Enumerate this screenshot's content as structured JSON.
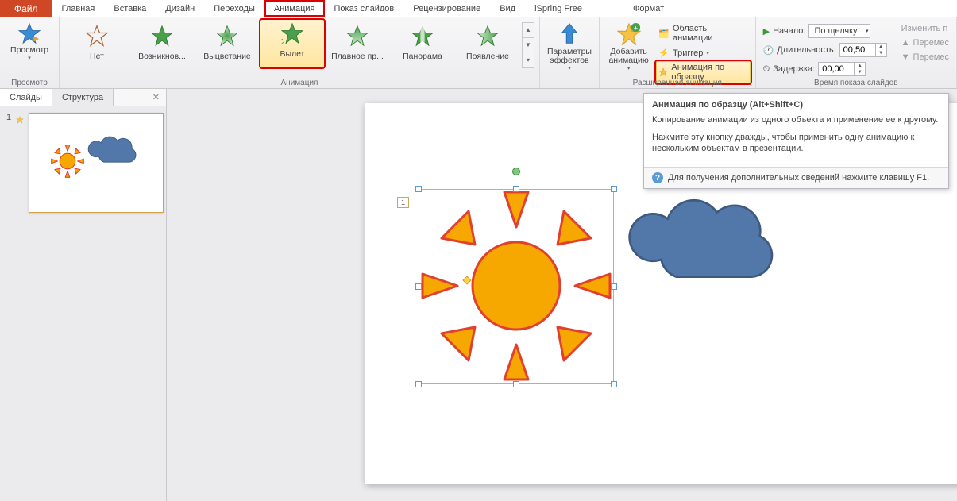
{
  "tabs": {
    "file": "Файл",
    "home": "Главная",
    "insert": "Вставка",
    "design": "Дизайн",
    "transitions": "Переходы",
    "animation": "Анимация",
    "slideshow": "Показ слайдов",
    "review": "Рецензирование",
    "view": "Вид",
    "ispring": "iSpring Free",
    "format": "Формат"
  },
  "ribbon": {
    "preview": {
      "label": "Просмотр",
      "group": "Просмотр"
    },
    "gallery": {
      "group": "Анимация",
      "items": {
        "none": "Нет",
        "appear": "Возникнов...",
        "fade": "Выцветание",
        "flyin": "Вылет",
        "floatin": "Плавное пр...",
        "panorama": "Панорама",
        "appear2": "Появление"
      }
    },
    "effect_options": "Параметры эффектов",
    "add_animation": "Добавить анимацию",
    "adv_group": "Расширенная анимация",
    "anim_pane": "Область анимации",
    "trigger": "Триггер",
    "anim_painter": "Анимация по образцу",
    "timing_group": "Время показа слайдов",
    "start_label": "Начало:",
    "start_value": "По щелчку",
    "duration_label": "Длительность:",
    "duration_value": "00,50",
    "delay_label": "Задержка:",
    "delay_value": "00,00",
    "reorder": "Изменить п",
    "move_earlier": "Перемес",
    "move_later": "Перемес"
  },
  "side": {
    "slides_tab": "Слайды",
    "outline_tab": "Структура",
    "slide_num": "1"
  },
  "canvas": {
    "anim_tag": "1"
  },
  "tooltip": {
    "title": "Анимация по образцу (Alt+Shift+C)",
    "p1": "Копирование анимации из одного объекта и применение ее к другому.",
    "p2": "Нажмите эту кнопку дважды, чтобы применить одну анимацию к нескольким объектам в презентации.",
    "foot": "Для получения дополнительных сведений нажмите клавишу F1."
  }
}
